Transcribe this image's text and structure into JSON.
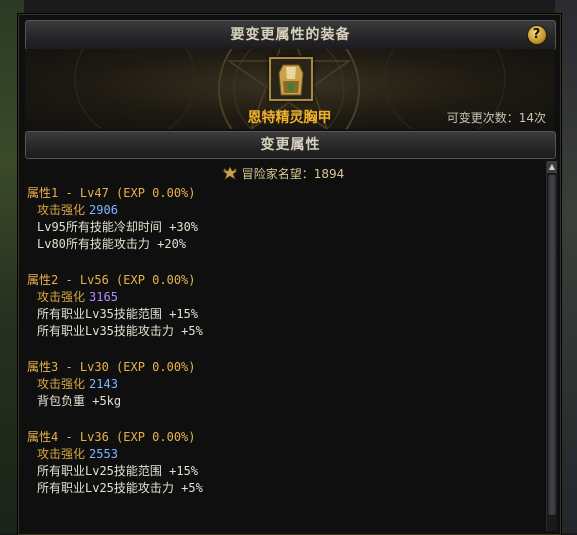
{
  "window": {
    "title": "要变更属性的装备",
    "help_label": "?"
  },
  "item": {
    "name": "恩特精灵胸甲",
    "icon": "chest-armor-icon",
    "change_count_label": "可变更次数：14次"
  },
  "section": {
    "title": "变更属性"
  },
  "fame": {
    "label": "冒险家名望：1894",
    "icon": "fame-crest-icon"
  },
  "attributes": [
    {
      "title": "属性1 - Lv47 (EXP 0.00%)",
      "main_label": "攻击强化",
      "main_value": "2906",
      "main_color": "#7fb6ff",
      "effects": [
        "Lv95所有技能冷却时间 +30%",
        "Lv80所有技能攻击力 +20%"
      ]
    },
    {
      "title": "属性2 - Lv56 (EXP 0.00%)",
      "main_label": "攻击强化",
      "main_value": "3165",
      "main_color": "#b48cff",
      "effects": [
        "所有职业Lv35技能范围 +15%",
        "所有职业Lv35技能攻击力 +5%"
      ]
    },
    {
      "title": "属性3 - Lv30 (EXP 0.00%)",
      "main_label": "攻击强化",
      "main_value": "2143",
      "main_color": "#7fb6ff",
      "effects": [
        "背包负重 +5kg"
      ]
    },
    {
      "title": "属性4 - Lv36 (EXP 0.00%)",
      "main_label": "攻击强化",
      "main_value": "2553",
      "main_color": "#7fb6ff",
      "effects": [
        "所有职业Lv25技能范围 +15%",
        "所有职业Lv25技能攻击力 +5%"
      ]
    }
  ],
  "colors": {
    "gold": "#f0b02b",
    "attr_title": "#e8b24a",
    "label": "#d9a641",
    "text": "#e4e0d0"
  }
}
